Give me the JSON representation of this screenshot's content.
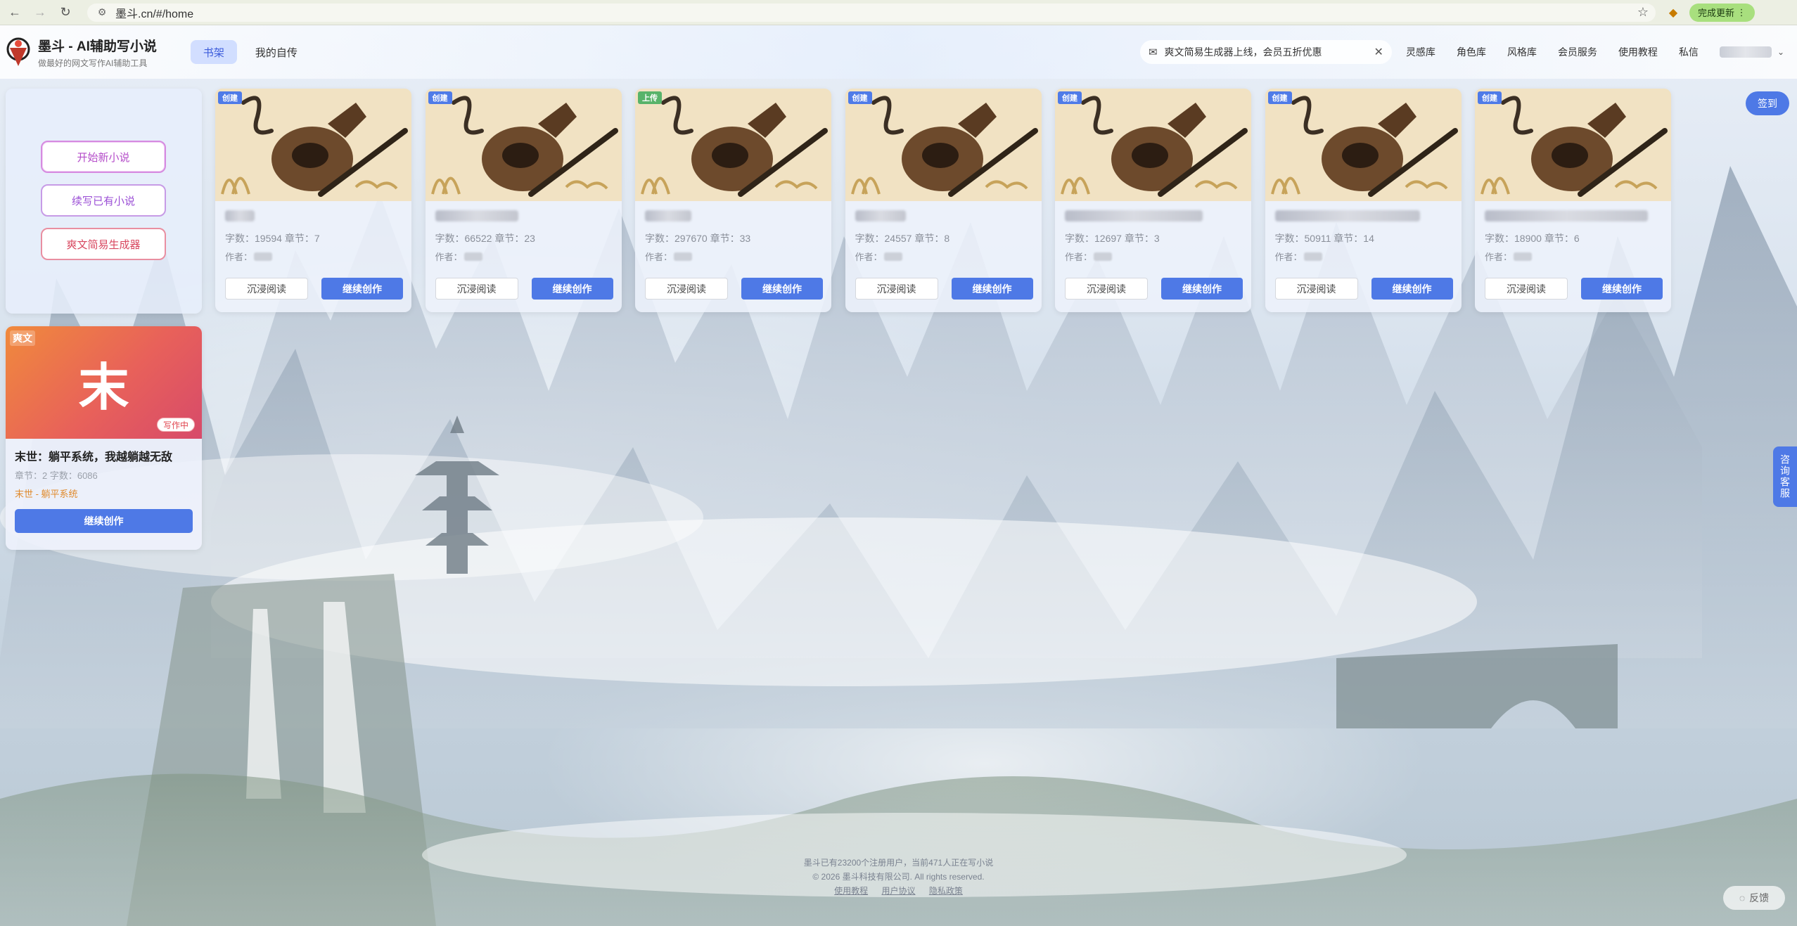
{
  "browser": {
    "url": "墨斗.cn/#/home",
    "update_label": "完成更新"
  },
  "header": {
    "brand_title": "墨斗 - AI辅助写小说",
    "brand_sub": "做最好的网文写作AI辅助工具",
    "tabs": [
      {
        "label": "书架",
        "active": true
      },
      {
        "label": "我的自传",
        "active": false
      }
    ],
    "notice": "爽文简易生成器上线，会员五折优惠",
    "menu": [
      "灵感库",
      "角色库",
      "风格库",
      "会员服务",
      "使用教程",
      "私信"
    ]
  },
  "actions": {
    "new_novel": "开始新小说",
    "continue_novel": "续写已有小说",
    "generator": "爽文简易生成器"
  },
  "books": [
    {
      "badge": "创建",
      "badge_type": "create",
      "stats": "字数：19594 章节：7"
    },
    {
      "badge": "创建",
      "badge_type": "create",
      "stats": "字数：66522 章节：23"
    },
    {
      "badge": "上传",
      "badge_type": "upload",
      "stats": "字数：297670 章节：33"
    },
    {
      "badge": "创建",
      "badge_type": "create",
      "stats": "字数：24557 章节：8"
    },
    {
      "badge": "创建",
      "badge_type": "create",
      "stats": "字数：12697 章节：3"
    },
    {
      "badge": "创建",
      "badge_type": "create",
      "stats": "字数：50911 章节：14"
    },
    {
      "badge": "创建",
      "badge_type": "create",
      "stats": "字数：18900 章节：6"
    }
  ],
  "book_labels": {
    "author": "作者：",
    "read": "沉浸阅读",
    "continue": "继续创作"
  },
  "novel": {
    "tag": "爽文",
    "cover_char": "末",
    "status": "写作中",
    "title": "末世：躺平系统，我越躺越无敌",
    "stats": "章节：2  字数：6086",
    "genre": "末世 - 躺平系统",
    "button": "继续创作"
  },
  "floating": {
    "signin": "签到",
    "service": "咨询客服",
    "feedback": "反馈"
  },
  "footer": {
    "line1": "墨斗已有23200个注册用户，当前471人正在写小说",
    "line2": "© 2026 墨斗科技有限公司. All rights reserved.",
    "links": [
      "使用教程",
      "用户协议",
      "隐私政策"
    ]
  }
}
